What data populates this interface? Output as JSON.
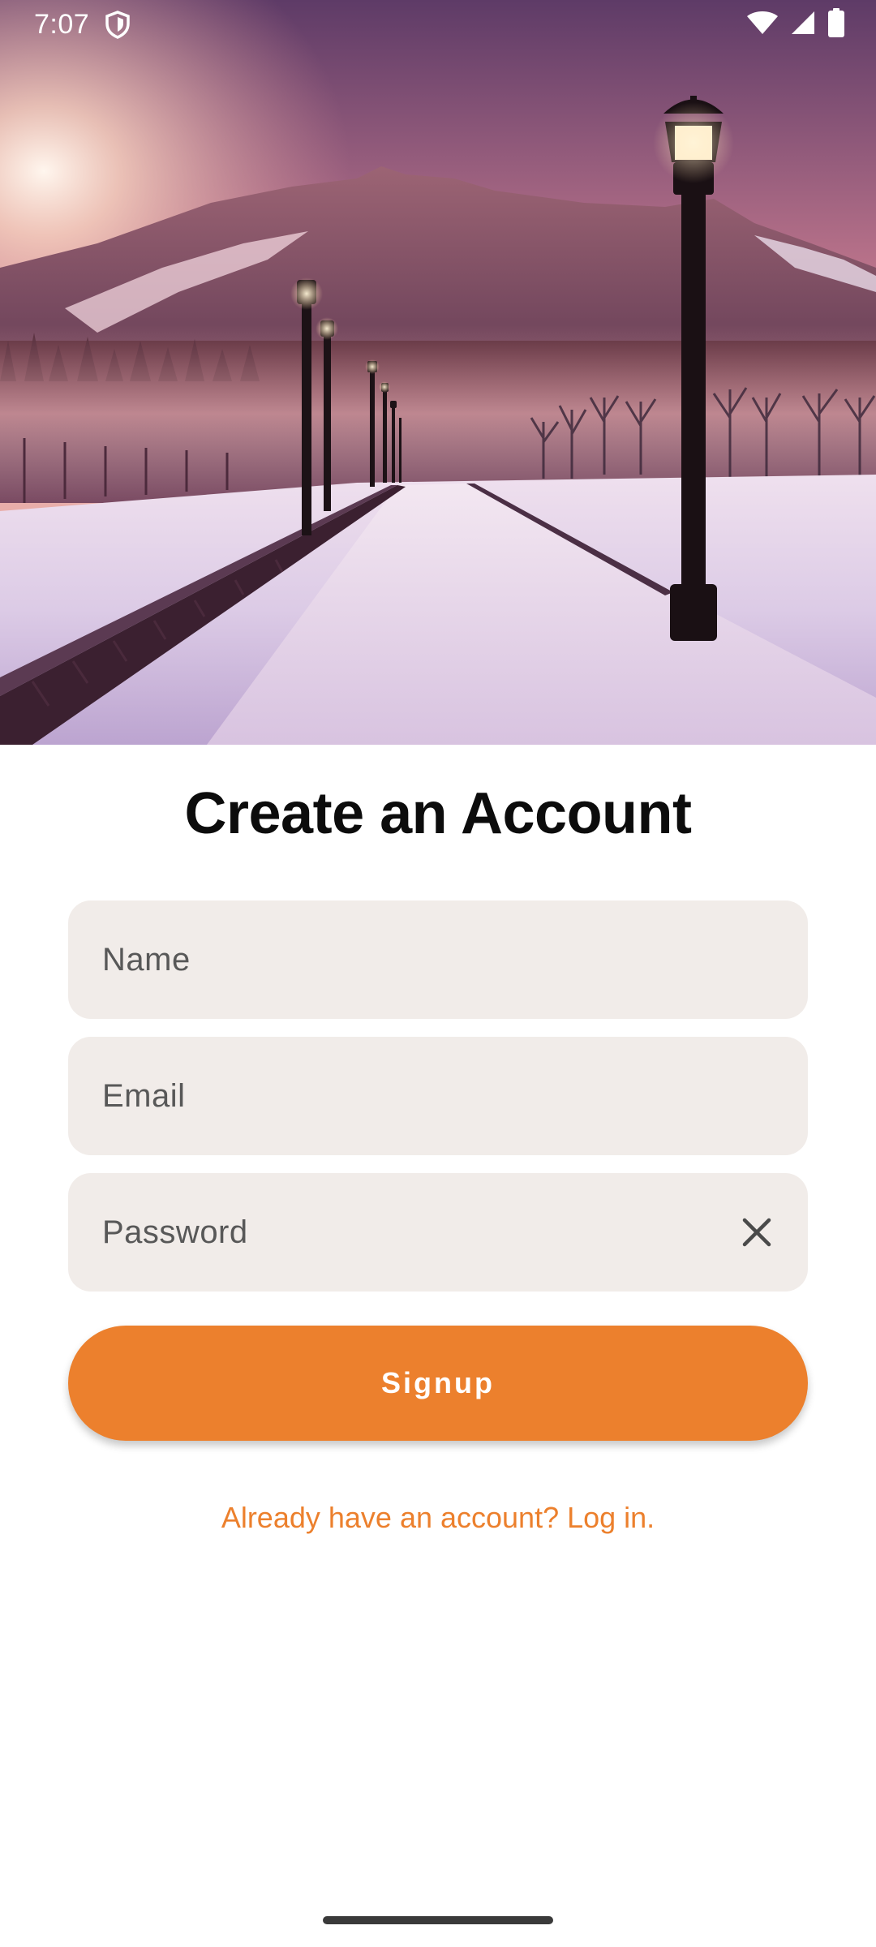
{
  "status_bar": {
    "time": "7:07",
    "icons": [
      "shield-icon",
      "wifi-icon",
      "cellular-signal-icon",
      "battery-icon"
    ]
  },
  "hero": {
    "image": "snowy-lamppost-path-at-sunset-illustration"
  },
  "form": {
    "title": "Create an Account",
    "name_placeholder": "Name",
    "email_placeholder": "Email",
    "password_placeholder": "Password",
    "clear_icon": "close-icon",
    "signup_label": "Signup",
    "login_link": "Already have an account? Log in."
  },
  "colors": {
    "accent": "#ec802d",
    "field_background": "#f1ece9",
    "title": "#0c0c0c"
  }
}
